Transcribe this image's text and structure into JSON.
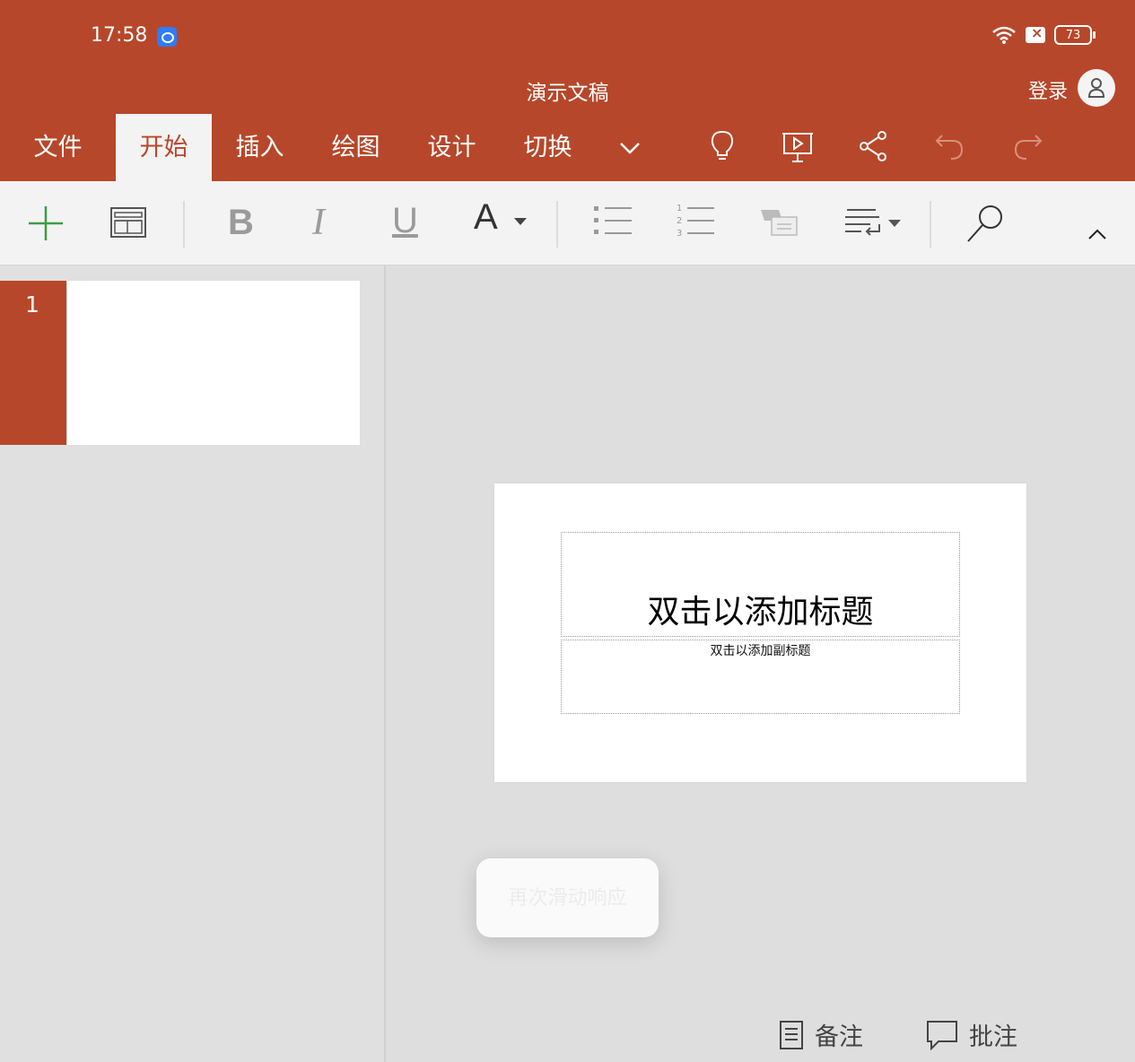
{
  "status_bar": {
    "time": "17:58",
    "battery": "73",
    "icons": [
      "app-notification-icon",
      "wifi-icon",
      "sim-icon",
      "battery-icon"
    ]
  },
  "header": {
    "doc_title": "演示文稿",
    "login_label": "登录",
    "brand_color": "#b7472a"
  },
  "tabs": [
    {
      "label": "文件",
      "active": false
    },
    {
      "label": "开始",
      "active": true
    },
    {
      "label": "插入",
      "active": false
    },
    {
      "label": "绘图",
      "active": false
    },
    {
      "label": "设计",
      "active": false
    },
    {
      "label": "切换",
      "active": false
    }
  ],
  "header_icons": [
    "chevron-down-icon",
    "lightbulb-icon",
    "present-icon",
    "share-icon",
    "undo-icon",
    "redo-icon"
  ],
  "ribbon": {
    "bold": "B",
    "italic": "I",
    "underline": "U",
    "font_color": "A",
    "icons": [
      "new-slide-icon",
      "layout-icon",
      "bold-icon",
      "italic-icon",
      "underline-icon",
      "font-color-icon",
      "bullet-list-icon",
      "numbered-list-icon",
      "shape-icon",
      "text-wrap-icon",
      "search-icon",
      "collapse-ribbon-icon"
    ]
  },
  "slides_panel": {
    "slide_number": "1"
  },
  "slide": {
    "title_placeholder": "双击以添加标题",
    "subtitle_placeholder": "双击以添加副标题"
  },
  "toast": {
    "text": "再次滑动响应"
  },
  "bottom": {
    "notes_label": "备注",
    "comments_label": "批注"
  }
}
